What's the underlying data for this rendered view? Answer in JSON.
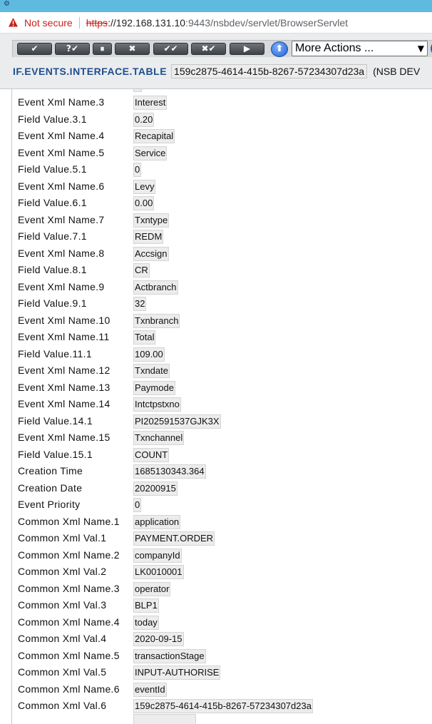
{
  "browser": {
    "not_secure_label": "Not secure",
    "url_scheme": "https",
    "url_host": "://192.168.131.10",
    "url_port_path": ":9443/nsbdev/servlet/BrowserServlet"
  },
  "toolbar": {
    "buttons": [
      {
        "name": "validate-button",
        "glyph": "✔"
      },
      {
        "name": "query-validate-button",
        "glyph": "?✔"
      },
      {
        "name": "hold-button",
        "glyph": "⏸"
      },
      {
        "name": "delete-button",
        "glyph": "✖"
      },
      {
        "name": "commit-button",
        "glyph": "✔✔"
      },
      {
        "name": "reverse-button",
        "glyph": "✖✔"
      },
      {
        "name": "next-button",
        "glyph": "▶"
      }
    ],
    "help_glyph": "⬆",
    "actions_select_value": "More Actions ...",
    "colors": {
      "button": "#4d5156",
      "help": "#1f5fd1",
      "app_name": "#1e4f8c"
    }
  },
  "record": {
    "application": "IF.EVENTS.INTERFACE.TABLE",
    "record_id": "159c2875-4614-415b-8267-57234307d23a",
    "company_suffix": "(NSB DEV"
  },
  "fields": [
    {
      "label": "Event Xml Name.3",
      "value": "Interest"
    },
    {
      "label": "Field Value.3.1",
      "value": "0.20"
    },
    {
      "label": "Event Xml Name.4",
      "value": "Recapital"
    },
    {
      "label": "Event Xml Name.5",
      "value": "Service"
    },
    {
      "label": "Field Value.5.1",
      "value": "0"
    },
    {
      "label": "Event Xml Name.6",
      "value": "Levy"
    },
    {
      "label": "Field Value.6.1",
      "value": "0.00"
    },
    {
      "label": "Event Xml Name.7",
      "value": "Txntype"
    },
    {
      "label": "Field Value.7.1",
      "value": "REDM"
    },
    {
      "label": "Event Xml Name.8",
      "value": "Accsign"
    },
    {
      "label": "Field Value.8.1",
      "value": "CR"
    },
    {
      "label": "Event Xml Name.9",
      "value": "Actbranch"
    },
    {
      "label": "Field Value.9.1",
      "value": "32"
    },
    {
      "label": "Event Xml Name.10",
      "value": "Txnbranch"
    },
    {
      "label": "Event Xml Name.11",
      "value": "Total"
    },
    {
      "label": "Field Value.11.1",
      "value": "109.00"
    },
    {
      "label": "Event Xml Name.12",
      "value": "Txndate"
    },
    {
      "label": "Event Xml Name.13",
      "value": "Paymode"
    },
    {
      "label": "Event Xml Name.14",
      "value": "Intctpstxno"
    },
    {
      "label": "Field Value.14.1",
      "value": "PI202591537GJK3X"
    },
    {
      "label": "Event Xml Name.15",
      "value": "Txnchannel"
    },
    {
      "label": "Field Value.15.1",
      "value": "COUNT"
    },
    {
      "label": "Creation Time",
      "value": "1685130343.364"
    },
    {
      "label": "Creation Date",
      "value": "20200915"
    },
    {
      "label": "Event Priority",
      "value": "0"
    },
    {
      "label": "Common Xml Name.1",
      "value": "application"
    },
    {
      "label": "Common Xml Val.1",
      "value": "PAYMENT.ORDER"
    },
    {
      "label": "Common Xml Name.2",
      "value": "companyId"
    },
    {
      "label": "Common Xml Val.2",
      "value": "LK0010001"
    },
    {
      "label": "Common Xml Name.3",
      "value": "operator"
    },
    {
      "label": "Common Xml Val.3",
      "value": "BLP1"
    },
    {
      "label": "Common Xml Name.4",
      "value": "today"
    },
    {
      "label": "Common Xml Val.4",
      "value": "2020-09-15"
    },
    {
      "label": "Common Xml Name.5",
      "value": "transactionStage"
    },
    {
      "label": "Common Xml Val.5",
      "value": "INPUT-AUTHORISE"
    },
    {
      "label": "Common Xml Name.6",
      "value": "eventId"
    },
    {
      "label": "Common Xml Val.6",
      "value": "159c2875-4614-415b-8267-57234307d23a"
    }
  ]
}
